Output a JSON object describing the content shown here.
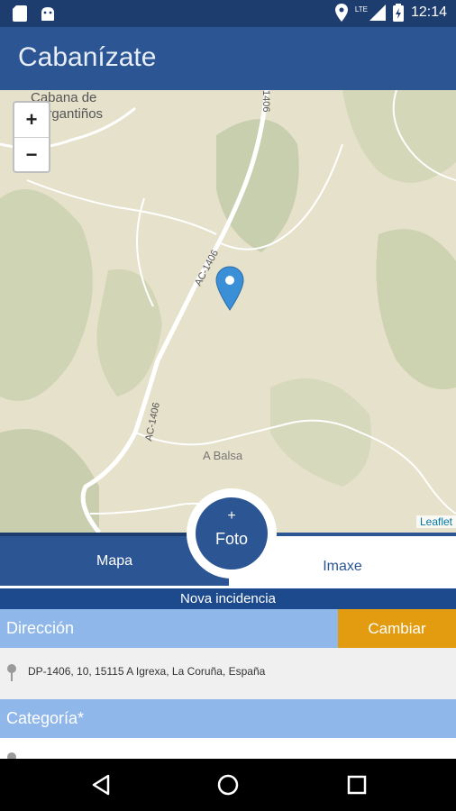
{
  "status_bar": {
    "time": "12:14",
    "left_icons": [
      "sd-card-icon",
      "android-icon"
    ],
    "right_icons": [
      "location-icon",
      "lte-signal-icon",
      "battery-charging-icon"
    ],
    "network_label": "LTE"
  },
  "app_bar": {
    "title": "Cabanízate"
  },
  "map": {
    "labels": {
      "town_top": "Cabana de",
      "town_top_2": "Bergantiños",
      "road_1": "AC-1406",
      "road_2": "AC-1406",
      "road_3": "1406",
      "village": "A Balsa"
    },
    "zoom_in_label": "+",
    "zoom_out_label": "−",
    "attribution": "Leaflet",
    "marker_icon": "map-pin-icon"
  },
  "tabs": {
    "map_label": "Mapa",
    "image_label": "Imaxe"
  },
  "fab": {
    "plus": "+",
    "label": "Foto"
  },
  "banner": {
    "text": "Nova incidencia"
  },
  "address_section": {
    "title": "Dirección",
    "change_button": "Cambiar",
    "value": "DP-1406, 10, 15115 A Igrexa, La Coruña, España",
    "icon": "pin-icon"
  },
  "category_section": {
    "title": "Categoría*"
  },
  "nav": {
    "back": "back-icon",
    "home": "home-icon",
    "recents": "recents-icon"
  },
  "colors": {
    "app_bar": "#2c5594",
    "status_bar": "#1d3d6e",
    "section": "#8fb7ea",
    "accent": "#e39b10",
    "marker": "#3a8fd6"
  }
}
